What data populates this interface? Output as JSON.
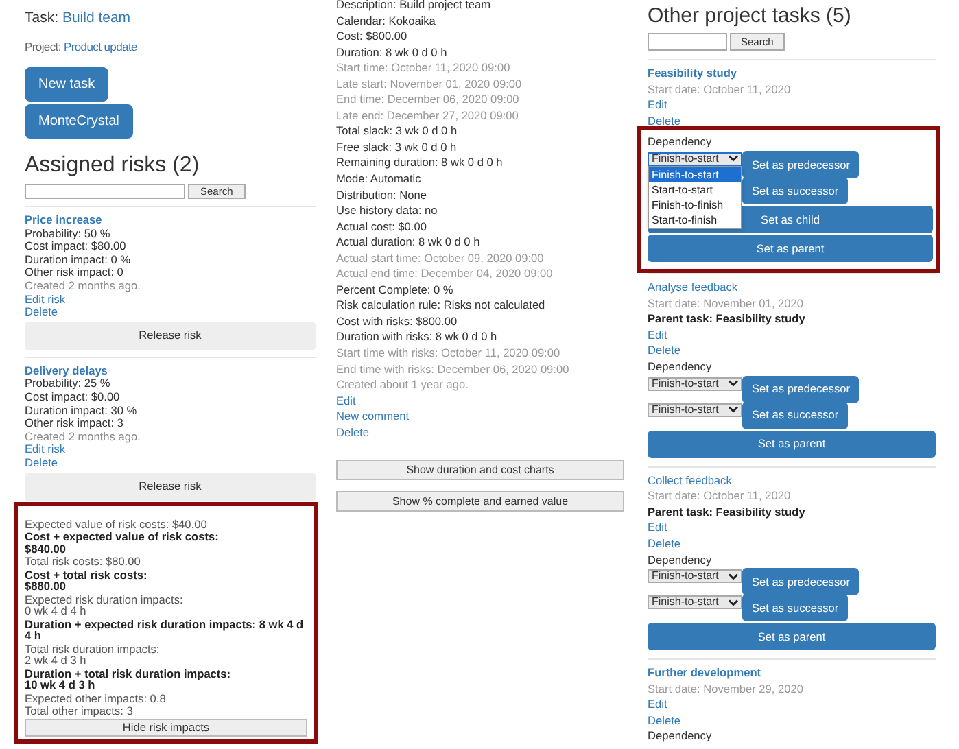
{
  "task": {
    "label": "Task:",
    "name": "Build team"
  },
  "project": {
    "label": "Project:",
    "name": "Product update"
  },
  "buttons": [
    "New task",
    "MonteCrystal"
  ],
  "risks_panel": {
    "title": "Assigned risks (2)",
    "search_button": "Search",
    "risks": [
      {
        "name": "Price increase",
        "lines": [
          "Probability: 50 %",
          "Cost impact: $80.00",
          "Duration impact: 0 %",
          "Other risk impact: 0"
        ],
        "created": "Created 2 months ago.",
        "links": [
          "Edit risk",
          "Delete"
        ],
        "button": "Release risk"
      },
      {
        "name": "Delivery delays",
        "lines": [
          "Probability: 25 %",
          "Cost impact: $0.00",
          "Duration impact: 30 %",
          "Other risk impact: 3"
        ],
        "created": "Created 2 months ago.",
        "links": [
          "Edit risk",
          "Delete"
        ],
        "button": "Release risk"
      }
    ],
    "summary": {
      "highlighted": true,
      "items": [
        {
          "kind": "plain",
          "text": "Expected value of risk costs: $40.00"
        },
        {
          "kind": "bold",
          "text": "Cost + expected value of risk costs:\n$840.00"
        },
        {
          "kind": "plain",
          "text": "Total risk costs: $80.00"
        },
        {
          "kind": "bold",
          "text": "Cost + total risk costs:\n$880.00"
        },
        {
          "kind": "plain",
          "text": "Expected risk duration impacts:\n0 wk 4 d 4 h"
        },
        {
          "kind": "bold",
          "text": "Duration + expected risk duration impacts: 8 wk 4 d 4 h"
        },
        {
          "kind": "plain",
          "text": "Total risk duration impacts:\n2 wk 4 d 3 h"
        },
        {
          "kind": "bold",
          "text": "Duration + total risk duration impacts:\n10 wk 4 d 3 h"
        },
        {
          "kind": "plain",
          "text": "Expected other impacts: 0.8"
        },
        {
          "kind": "plain",
          "text": "Total other impacts: 3"
        }
      ],
      "button": "Hide risk impacts"
    }
  },
  "details": {
    "lines": [
      {
        "text": "Description: Build project team",
        "muted": false
      },
      {
        "text": "Calendar: Kokoaika",
        "muted": false
      },
      {
        "text": "Cost: $800.00",
        "muted": false
      },
      {
        "text": "Duration: 8 wk 0 d 0 h",
        "muted": false
      },
      {
        "text": "Start time: October 11, 2020 09:00",
        "muted": true
      },
      {
        "text": "Late start: November 01, 2020 09:00",
        "muted": true
      },
      {
        "text": "End time: December 06, 2020 09:00",
        "muted": true
      },
      {
        "text": "Late end: December 27, 2020 09:00",
        "muted": true
      },
      {
        "text": "Total slack: 3 wk 0 d 0 h",
        "muted": false
      },
      {
        "text": "Free slack: 3 wk 0 d 0 h",
        "muted": false
      },
      {
        "text": "Remaining duration: 8 wk 0 d 0 h",
        "muted": false
      },
      {
        "text": "Mode: Automatic",
        "muted": false
      },
      {
        "text": "Distribution: None",
        "muted": false
      },
      {
        "text": "Use history data: no",
        "muted": false
      },
      {
        "text": "Actual cost: $0.00",
        "muted": false
      },
      {
        "text": "Actual duration: 8 wk 0 d 0 h",
        "muted": false
      },
      {
        "text": "Actual start time: October 09, 2020 09:00",
        "muted": true
      },
      {
        "text": "Actual end time: December 04, 2020 09:00",
        "muted": true
      },
      {
        "text": "Percent Complete: 0 %",
        "muted": false
      },
      {
        "text": "Risk calculation rule: Risks not calculated",
        "muted": false
      },
      {
        "text": "Cost with risks: $800.00",
        "muted": false
      },
      {
        "text": "Duration with risks: 8 wk 0 d 0 h",
        "muted": false
      },
      {
        "text": "Start time with risks: October 11, 2020 09:00",
        "muted": true
      },
      {
        "text": "End time with risks: December 06, 2020 09:00",
        "muted": true
      },
      {
        "text": "Created about 1 year ago.",
        "muted": true
      }
    ],
    "links": [
      "Edit",
      "New comment",
      "Delete"
    ],
    "buttons": [
      "Show duration and cost charts",
      "Show % complete and earned value"
    ]
  },
  "other_tasks": {
    "title": "Other project tasks (5)",
    "search_button": "Search",
    "tasks": [
      {
        "name": "Feasibility study",
        "bold": true,
        "start": "Start date: October 11, 2020",
        "links": [
          "Edit",
          "Delete"
        ],
        "highlighted": true,
        "dependency_label": "Dependency",
        "rows": [
          {
            "select": "Finish-to-start",
            "open": true,
            "options": [
              {
                "label": "Finish-to-start",
                "selected": true
              },
              {
                "label": "Start-to-start",
                "selected": false
              },
              {
                "label": "Finish-to-finish",
                "selected": false
              },
              {
                "label": "Start-to-finish",
                "selected": false
              }
            ],
            "button": "Set as predecessor"
          },
          {
            "button": "Set as successor"
          }
        ],
        "wide_buttons": [
          "Set as child",
          "Set as parent"
        ]
      },
      {
        "name": "Analyse feedback",
        "bold": false,
        "start": "Start date: November 01, 2020",
        "parent": "Parent task: Feasibility study",
        "links": [
          "Edit",
          "Delete"
        ],
        "highlighted": false,
        "dependency_label": "Dependency",
        "rows": [
          {
            "select": "Finish-to-start",
            "open": false,
            "button": "Set as predecessor"
          },
          {
            "select": "Finish-to-start",
            "open": false,
            "button": "Set as successor"
          }
        ],
        "wide_buttons": [
          "Set as parent"
        ]
      },
      {
        "name": "Collect feedback",
        "bold": false,
        "start": "Start date: October 11, 2020",
        "parent": "Parent task: Feasibility study",
        "links": [
          "Edit",
          "Delete"
        ],
        "highlighted": false,
        "dependency_label": "Dependency",
        "rows": [
          {
            "select": "Finish-to-start",
            "open": false,
            "button": "Set as predecessor"
          },
          {
            "select": "Finish-to-start",
            "open": false,
            "button": "Set as successor"
          }
        ],
        "wide_buttons": [
          "Set as parent"
        ]
      },
      {
        "name": "Further development",
        "bold": true,
        "start": "Start date: November 29, 2020",
        "links": [
          "Edit",
          "Delete"
        ],
        "highlighted": false,
        "dependency_label": "Dependency"
      }
    ]
  }
}
